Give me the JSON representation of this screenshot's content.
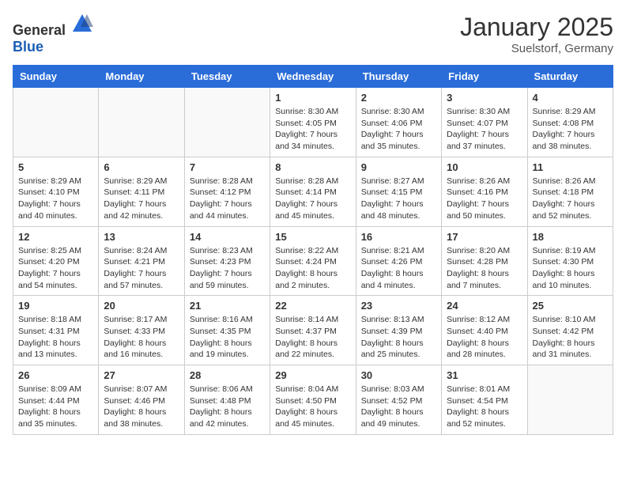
{
  "logo": {
    "general": "General",
    "blue": "Blue"
  },
  "title": "January 2025",
  "location": "Suelstorf, Germany",
  "weekdays": [
    "Sunday",
    "Monday",
    "Tuesday",
    "Wednesday",
    "Thursday",
    "Friday",
    "Saturday"
  ],
  "weeks": [
    [
      {
        "day": "",
        "info": ""
      },
      {
        "day": "",
        "info": ""
      },
      {
        "day": "",
        "info": ""
      },
      {
        "day": "1",
        "info": "Sunrise: 8:30 AM\nSunset: 4:05 PM\nDaylight: 7 hours\nand 34 minutes."
      },
      {
        "day": "2",
        "info": "Sunrise: 8:30 AM\nSunset: 4:06 PM\nDaylight: 7 hours\nand 35 minutes."
      },
      {
        "day": "3",
        "info": "Sunrise: 8:30 AM\nSunset: 4:07 PM\nDaylight: 7 hours\nand 37 minutes."
      },
      {
        "day": "4",
        "info": "Sunrise: 8:29 AM\nSunset: 4:08 PM\nDaylight: 7 hours\nand 38 minutes."
      }
    ],
    [
      {
        "day": "5",
        "info": "Sunrise: 8:29 AM\nSunset: 4:10 PM\nDaylight: 7 hours\nand 40 minutes."
      },
      {
        "day": "6",
        "info": "Sunrise: 8:29 AM\nSunset: 4:11 PM\nDaylight: 7 hours\nand 42 minutes."
      },
      {
        "day": "7",
        "info": "Sunrise: 8:28 AM\nSunset: 4:12 PM\nDaylight: 7 hours\nand 44 minutes."
      },
      {
        "day": "8",
        "info": "Sunrise: 8:28 AM\nSunset: 4:14 PM\nDaylight: 7 hours\nand 45 minutes."
      },
      {
        "day": "9",
        "info": "Sunrise: 8:27 AM\nSunset: 4:15 PM\nDaylight: 7 hours\nand 48 minutes."
      },
      {
        "day": "10",
        "info": "Sunrise: 8:26 AM\nSunset: 4:16 PM\nDaylight: 7 hours\nand 50 minutes."
      },
      {
        "day": "11",
        "info": "Sunrise: 8:26 AM\nSunset: 4:18 PM\nDaylight: 7 hours\nand 52 minutes."
      }
    ],
    [
      {
        "day": "12",
        "info": "Sunrise: 8:25 AM\nSunset: 4:20 PM\nDaylight: 7 hours\nand 54 minutes."
      },
      {
        "day": "13",
        "info": "Sunrise: 8:24 AM\nSunset: 4:21 PM\nDaylight: 7 hours\nand 57 minutes."
      },
      {
        "day": "14",
        "info": "Sunrise: 8:23 AM\nSunset: 4:23 PM\nDaylight: 7 hours\nand 59 minutes."
      },
      {
        "day": "15",
        "info": "Sunrise: 8:22 AM\nSunset: 4:24 PM\nDaylight: 8 hours\nand 2 minutes."
      },
      {
        "day": "16",
        "info": "Sunrise: 8:21 AM\nSunset: 4:26 PM\nDaylight: 8 hours\nand 4 minutes."
      },
      {
        "day": "17",
        "info": "Sunrise: 8:20 AM\nSunset: 4:28 PM\nDaylight: 8 hours\nand 7 minutes."
      },
      {
        "day": "18",
        "info": "Sunrise: 8:19 AM\nSunset: 4:30 PM\nDaylight: 8 hours\nand 10 minutes."
      }
    ],
    [
      {
        "day": "19",
        "info": "Sunrise: 8:18 AM\nSunset: 4:31 PM\nDaylight: 8 hours\nand 13 minutes."
      },
      {
        "day": "20",
        "info": "Sunrise: 8:17 AM\nSunset: 4:33 PM\nDaylight: 8 hours\nand 16 minutes."
      },
      {
        "day": "21",
        "info": "Sunrise: 8:16 AM\nSunset: 4:35 PM\nDaylight: 8 hours\nand 19 minutes."
      },
      {
        "day": "22",
        "info": "Sunrise: 8:14 AM\nSunset: 4:37 PM\nDaylight: 8 hours\nand 22 minutes."
      },
      {
        "day": "23",
        "info": "Sunrise: 8:13 AM\nSunset: 4:39 PM\nDaylight: 8 hours\nand 25 minutes."
      },
      {
        "day": "24",
        "info": "Sunrise: 8:12 AM\nSunset: 4:40 PM\nDaylight: 8 hours\nand 28 minutes."
      },
      {
        "day": "25",
        "info": "Sunrise: 8:10 AM\nSunset: 4:42 PM\nDaylight: 8 hours\nand 31 minutes."
      }
    ],
    [
      {
        "day": "26",
        "info": "Sunrise: 8:09 AM\nSunset: 4:44 PM\nDaylight: 8 hours\nand 35 minutes."
      },
      {
        "day": "27",
        "info": "Sunrise: 8:07 AM\nSunset: 4:46 PM\nDaylight: 8 hours\nand 38 minutes."
      },
      {
        "day": "28",
        "info": "Sunrise: 8:06 AM\nSunset: 4:48 PM\nDaylight: 8 hours\nand 42 minutes."
      },
      {
        "day": "29",
        "info": "Sunrise: 8:04 AM\nSunset: 4:50 PM\nDaylight: 8 hours\nand 45 minutes."
      },
      {
        "day": "30",
        "info": "Sunrise: 8:03 AM\nSunset: 4:52 PM\nDaylight: 8 hours\nand 49 minutes."
      },
      {
        "day": "31",
        "info": "Sunrise: 8:01 AM\nSunset: 4:54 PM\nDaylight: 8 hours\nand 52 minutes."
      },
      {
        "day": "",
        "info": ""
      }
    ]
  ]
}
